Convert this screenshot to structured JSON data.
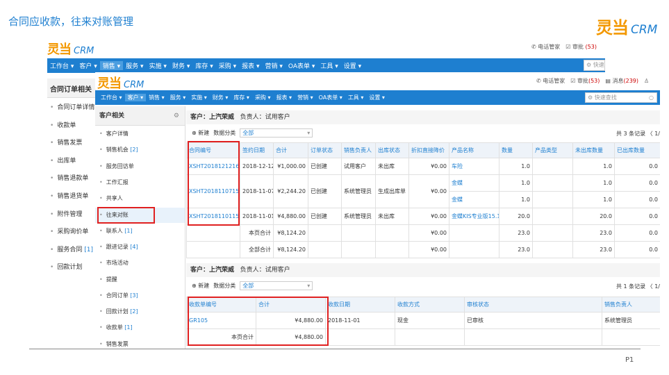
{
  "slide": {
    "title": "合同应收款，往来对账管理",
    "page_number": "P1"
  },
  "brand": {
    "logo_zh": "灵当",
    "logo_en": "CRM"
  },
  "back_window": {
    "header": {
      "phone": "电话管家",
      "approve": "审批",
      "approve_count": "(53)",
      "quick": "快速"
    },
    "nav": [
      "工作台 ▾",
      "客户 ▾",
      "销售 ▾",
      "服务 ▾",
      "实施 ▾",
      "财务 ▾",
      "库存 ▾",
      "采购 ▾",
      "报表 ▾",
      "营销 ▾",
      "OA表单 ▾",
      "工具 ▾",
      "设置 ▾"
    ],
    "sidebar_title": "合同订单相关",
    "sidebar_items": [
      {
        "label": "合同订单详情",
        "count": ""
      },
      {
        "label": "收款单",
        "count": ""
      },
      {
        "label": "销售发票",
        "count": ""
      },
      {
        "label": "出库单",
        "count": ""
      },
      {
        "label": "销售退款单",
        "count": ""
      },
      {
        "label": "销售退货单",
        "count": ""
      },
      {
        "label": "附件管理",
        "count": ""
      },
      {
        "label": "采购询价单",
        "count": ""
      },
      {
        "label": "服务合同",
        "count": "[1]"
      },
      {
        "label": "回款计划",
        "count": ""
      }
    ]
  },
  "front_window": {
    "header": {
      "phone": "电话管家",
      "approve": "审批",
      "approve_count": "(53)",
      "message": "消息",
      "message_count": "(239)",
      "search_placeholder": "快速查找"
    },
    "nav": [
      "工作台 ▾",
      "客户 ▾",
      "销售 ▾",
      "服务 ▾",
      "实施 ▾",
      "财务 ▾",
      "库存 ▾",
      "采购 ▾",
      "报表 ▾",
      "营销 ▾",
      "OA表单 ▾",
      "工具 ▾",
      "设置 ▾"
    ],
    "panel_title": "客户相关",
    "panel_items": [
      {
        "label": "客户详情",
        "count": ""
      },
      {
        "label": "销售机会",
        "count": "[2]"
      },
      {
        "label": "服务回访单",
        "count": ""
      },
      {
        "label": "工作汇报",
        "count": ""
      },
      {
        "label": "共享人",
        "count": ""
      },
      {
        "label": "往来对账",
        "count": ""
      },
      {
        "label": "联系人",
        "count": "[1]"
      },
      {
        "label": "跟进记录",
        "count": "[4]"
      },
      {
        "label": "市场活动",
        "count": ""
      },
      {
        "label": "提醒",
        "count": ""
      },
      {
        "label": "合同订单",
        "count": "[3]"
      },
      {
        "label": "回款计划",
        "count": "[2]"
      },
      {
        "label": "收款单",
        "count": "[1]"
      },
      {
        "label": "销售发票",
        "count": ""
      }
    ],
    "section1": {
      "customer_label": "客户：上汽荣威",
      "owner_label": "负责人：试用客户",
      "new_label": "新建",
      "category_label": "数据分类",
      "category_value": "全部",
      "count_label": "共 3 条记录 〈 1/",
      "columns": [
        "合同编号",
        "签约日期",
        "合计",
        "订单状态",
        "销售负责人",
        "出库状态",
        "折扣直接降价",
        "产品名称",
        "数量",
        "产品类型",
        "未出库数量",
        "已出库数量"
      ],
      "rows": [
        {
          "no": "XSHT20181212162",
          "date": "2018-12-12",
          "total": "¥1,000.00",
          "status": "已创建",
          "owner": "试用客户",
          "stock": "未出库",
          "discount": "¥0.00",
          "product": "车险",
          "qty": "1.0",
          "type": "",
          "unout": "1.0",
          "out": "0.0"
        },
        {
          "no": "XSHT20181107157",
          "date": "2018-11-07",
          "total": "¥2,244.20",
          "status": "已创建",
          "owner": "系统管理员",
          "stock": "生成出库单",
          "discount": "¥0.00",
          "product": "金蝶",
          "qty": "1.0",
          "type": "",
          "unout": "1.0",
          "out": "0.0",
          "product2": "金蝶",
          "qty2": "1.0",
          "unout2": "1.0",
          "out2": "0.0"
        },
        {
          "no": "XSHT20181101156",
          "date": "2018-11-01",
          "total": "¥4,880.00",
          "status": "已创建",
          "owner": "系统管理员",
          "stock": "未出库",
          "discount": "¥0.00",
          "product": "金蝶KIS专业版15.1",
          "qty": "20.0",
          "type": "",
          "unout": "20.0",
          "out": "0.0"
        }
      ],
      "page_total": {
        "label": "本页合计",
        "total": "¥8,124.20",
        "discount": "¥0.00",
        "qty": "23.0",
        "unout": "23.0",
        "out": "0.0"
      },
      "all_total": {
        "label": "全部合计",
        "total": "¥8,124.20",
        "discount": "¥0.00",
        "qty": "23.0",
        "unout": "23.0",
        "out": "0.0"
      }
    },
    "section2": {
      "customer_label": "客户：上汽荣威",
      "owner_label": "负责人：试用客户",
      "new_label": "新建",
      "category_label": "数据分类",
      "category_value": "全部",
      "count_label": "共 1 条记录 〈 1/",
      "columns": [
        "收款单编号",
        "合计",
        "收款日期",
        "收款方式",
        "审核状态",
        "销售负责人"
      ],
      "rows": [
        {
          "no": "GR105",
          "total": "¥4,880.00",
          "date": "2018-11-01",
          "method": "现金",
          "audit": "已审核",
          "owner": "系统管理员"
        }
      ],
      "page_total": {
        "label": "本页合计",
        "total": "¥4,880.00"
      }
    }
  }
}
